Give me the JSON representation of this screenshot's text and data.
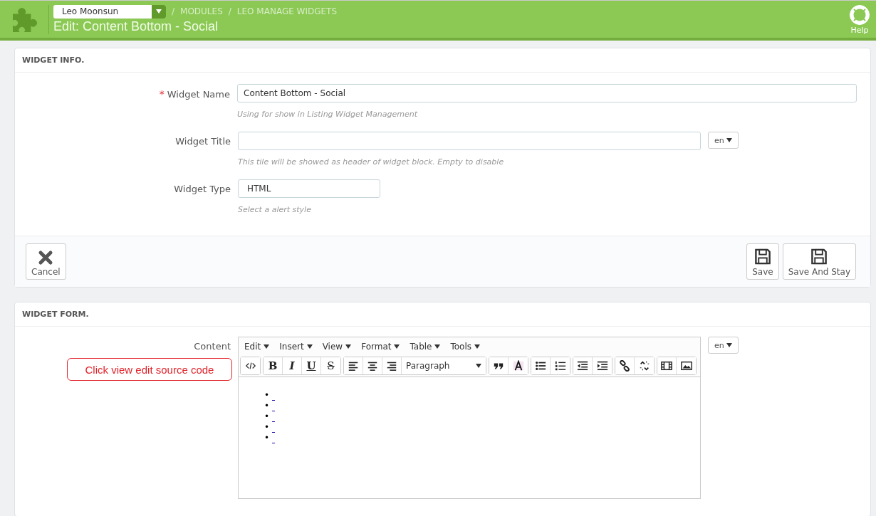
{
  "header": {
    "shop_select": "Leo Moonsun",
    "breadcrumb": [
      {
        "sep": "/",
        "label": "MODULES"
      },
      {
        "sep": "/",
        "label": "LEO MANAGE WIDGETS"
      }
    ],
    "title": "Edit: Content Bottom - Social",
    "help": "Help"
  },
  "widget_info": {
    "heading": "WIDGET INFO.",
    "fields": [
      {
        "label": "Widget Name",
        "required_mark": "*",
        "value": "Content Bottom - Social",
        "hint": "Using for show in Listing Widget Management"
      },
      {
        "label": "Widget Title",
        "hint": "This tile will be showed as header of widget block. Empty to disable",
        "lang": "en"
      },
      {
        "label": "Widget Type",
        "value": "HTML",
        "hint": "Select a alert style"
      }
    ],
    "buttons": [
      {
        "label": "Cancel",
        "kind": "cancel"
      },
      {
        "label": "Save",
        "kind": "save"
      },
      {
        "label": "Save And Stay",
        "kind": "save"
      }
    ]
  },
  "widget_form": {
    "heading": "WIDGET FORM.",
    "content_label": "Content",
    "lang": "en",
    "menu": [
      "Edit",
      "Insert",
      "View",
      "Format",
      "Table",
      "Tools"
    ],
    "toolbar": [
      [
        {
          "kind": "code"
        }
      ],
      [
        {
          "kind": "letter",
          "label": "B"
        },
        {
          "kind": "letter",
          "label": "I"
        },
        {
          "kind": "letter",
          "label": "U"
        },
        {
          "kind": "letter",
          "label": "S"
        }
      ],
      [
        {
          "kind": "align-left"
        },
        {
          "kind": "align-center"
        },
        {
          "kind": "align-right"
        },
        {
          "kind": "select",
          "label": "Paragraph"
        }
      ],
      [
        {
          "kind": "quote"
        },
        {
          "kind": "color"
        }
      ],
      [
        {
          "kind": "bullets"
        },
        {
          "kind": "numbers"
        }
      ],
      [
        {
          "kind": "outdent"
        },
        {
          "kind": "indent"
        }
      ],
      [
        {
          "kind": "link"
        },
        {
          "kind": "unlink"
        }
      ],
      [
        {
          "kind": "media"
        },
        {
          "kind": "image"
        }
      ]
    ],
    "list_items": [
      {
        "kind": "link",
        "bullet": "•"
      },
      {
        "kind": "link",
        "bullet": "•"
      },
      {
        "kind": "link",
        "bullet": "•"
      },
      {
        "kind": "link",
        "bullet": "•"
      },
      {
        "kind": "link",
        "bullet": "•"
      }
    ],
    "callout": "Click view edit source code"
  }
}
